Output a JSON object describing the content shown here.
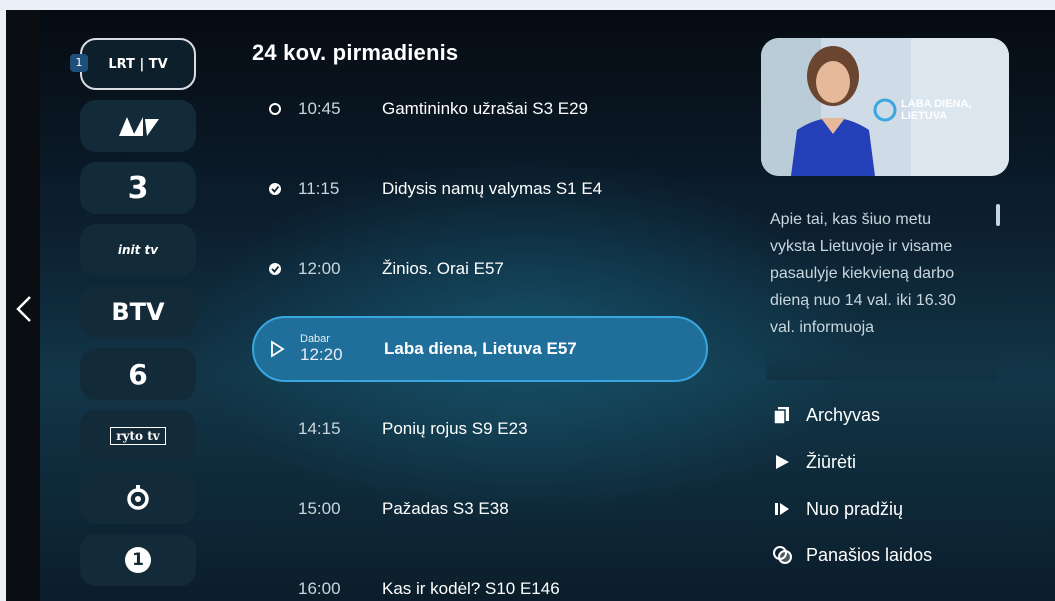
{
  "channels": [
    {
      "num": "1",
      "logo": "LRT | TV",
      "active": true
    },
    {
      "logo": "LNK"
    },
    {
      "logo": "3"
    },
    {
      "logo": "init tv"
    },
    {
      "logo": "BTV"
    },
    {
      "logo": "6"
    },
    {
      "logo": "ryto tv"
    },
    {
      "logo": "ring"
    },
    {
      "logo": "1"
    }
  ],
  "schedule": {
    "date": "24 kov. pirmadienis",
    "items": [
      {
        "time": "10:45",
        "title": "Gamtininko užrašai S3 E29",
        "icon": "circle-icon"
      },
      {
        "time": "11:15",
        "title": "Didysis namų valymas S1 E4",
        "icon": "check-icon"
      },
      {
        "time": "12:00",
        "title": "Žinios. Orai E57",
        "icon": "check-icon"
      },
      {
        "now_label": "Dabar",
        "time": "12:20",
        "title": "Laba diena, Lietuva E57",
        "icon": "play-outline-icon"
      },
      {
        "time": "14:15",
        "title": "Ponių rojus S9 E23"
      },
      {
        "time": "15:00",
        "title": "Pažadas S3 E38"
      },
      {
        "time": "16:00",
        "title": "Kas ir kodėl? S10 E146"
      }
    ]
  },
  "details": {
    "thumb_text": "LABA DIENA, LIETUVA",
    "description": "Apie tai, kas šiuo metu vyksta Lietuvoje ir visame pasaulyje kiekvieną darbo dieną nuo 14 val. iki 16.30 val. informuoja"
  },
  "actions": {
    "archive": "Archyvas",
    "watch": "Žiūrėti",
    "from_start": "Nuo pradžių",
    "similar": "Panašios laidos"
  },
  "colors": {
    "accent": "#3aa6df",
    "selected_bg": "#1f6f9a"
  }
}
